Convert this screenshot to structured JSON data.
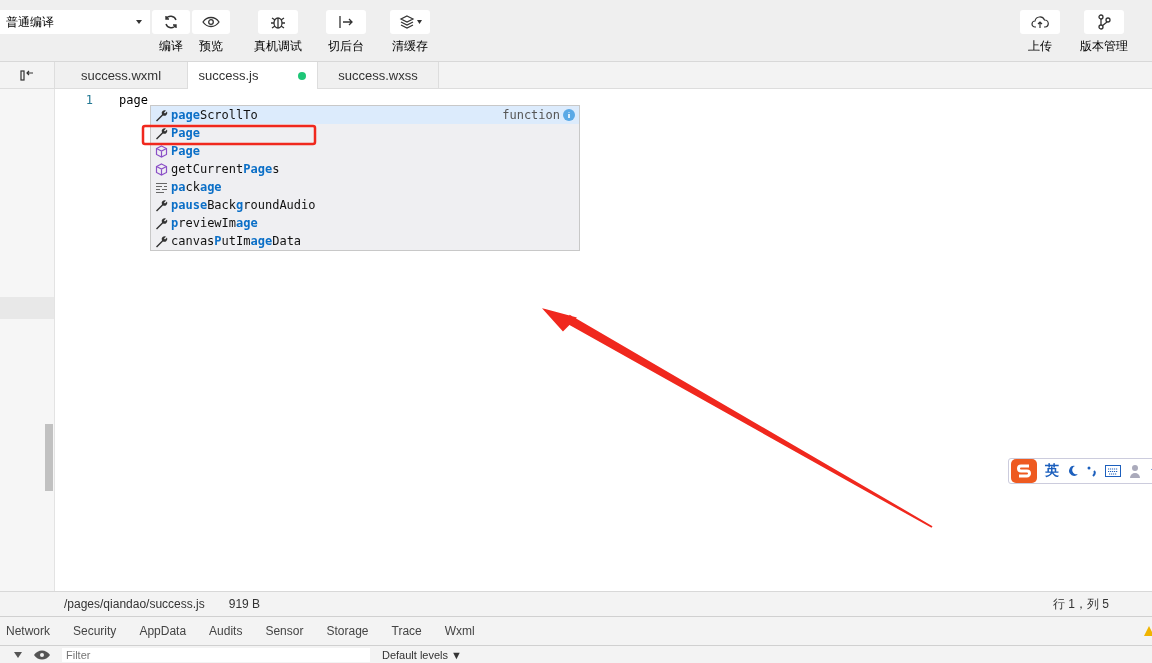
{
  "toolbar": {
    "mode_select": "普通编译",
    "left_buttons": [
      {
        "label": "编译"
      },
      {
        "label": "预览"
      },
      {
        "label": "真机调试"
      },
      {
        "label": "切后台"
      },
      {
        "label": "清缓存"
      }
    ],
    "right_buttons": [
      {
        "label": "上传"
      },
      {
        "label": "版本管理"
      }
    ]
  },
  "tabs": [
    {
      "label": "success.wxml",
      "selected": false,
      "modified": false
    },
    {
      "label": "success.js",
      "selected": true,
      "modified": true
    },
    {
      "label": "success.wxss",
      "selected": false,
      "modified": false
    }
  ],
  "editor": {
    "lines": [
      {
        "number": "1",
        "code": "page"
      }
    ]
  },
  "suggestions": {
    "detail": "function",
    "items": [
      {
        "kind": "method",
        "text": "**page**ScrollTo",
        "selected": true
      },
      {
        "kind": "method",
        "text": "**Page**",
        "selected": false
      },
      {
        "kind": "module",
        "text": "**Page**",
        "selected": false
      },
      {
        "kind": "module",
        "text": "getCurrent**Page**s",
        "selected": false
      },
      {
        "kind": "snippet",
        "text": "**pa**ck**age**",
        "selected": false
      },
      {
        "kind": "method",
        "text": "**pause**Back**g**roundAudio",
        "selected": false
      },
      {
        "kind": "method",
        "text": "**p**reviewIm**age**",
        "selected": false
      },
      {
        "kind": "method",
        "text": "canvas**P**utIm**age**Data",
        "selected": false
      }
    ]
  },
  "ime_bar": {
    "language": "英"
  },
  "status_bar": {
    "path": "/pages/qiandao/success.js",
    "size": "919 B",
    "position": "行 1，列 5"
  },
  "devtools": {
    "tabs": [
      "Network",
      "Security",
      "AppData",
      "Audits",
      "Sensor",
      "Storage",
      "Trace",
      "Wxml"
    ],
    "filter_placeholder": "Filter",
    "levels": "Default levels ▼"
  }
}
